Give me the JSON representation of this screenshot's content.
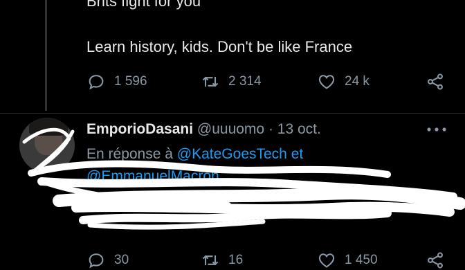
{
  "tweet1": {
    "text_line1": "Brits fight for you",
    "text_line2": "Learn history, kids. Don't be like France",
    "replies": "1 596",
    "retweets": "2 314",
    "likes": "24 k"
  },
  "reply": {
    "name": "EmporioDasani",
    "handle": "@uuuomo",
    "separator": "·",
    "date": "13 oct.",
    "in_reply_prefix": "En réponse à",
    "mention1": "@KateGoesTech",
    "conjunction": "et",
    "mention2": "@EmmanuelMacron",
    "replies": "30",
    "retweets": "16",
    "likes": "1 450"
  },
  "icons": {
    "reply": "reply-icon",
    "retweet": "retweet-icon",
    "like": "heart-icon",
    "share": "share-icon",
    "more": "more-icon"
  },
  "colors": {
    "background": "#000000",
    "text": "#e7e9ea",
    "secondary": "#8b98a5",
    "link": "#1d9bf0",
    "scribble": "#ffffff"
  }
}
